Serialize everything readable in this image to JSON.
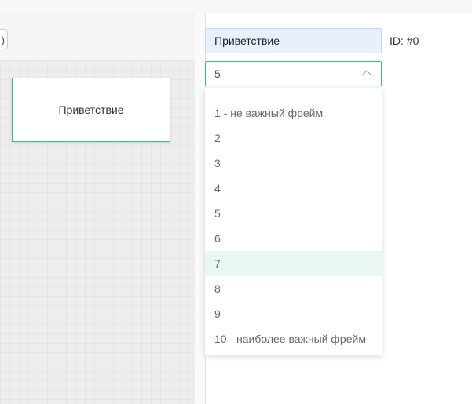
{
  "colors": {
    "accent": "#3fb98b",
    "hover_bg": "#eaf7f1",
    "input_bg": "#e8effd"
  },
  "toolbar": {
    "partial_button_glyph": ")"
  },
  "canvas": {
    "node_title": "Приветствие"
  },
  "properties": {
    "frame_name": "Приветствие",
    "frame_id": "ID: #0",
    "priority_selected": "5",
    "priority_icon": "chevron-up-icon",
    "priority_options": [
      "1 - не важный фрейм",
      "2",
      "3",
      "4",
      "5",
      "6",
      "7",
      "8",
      "9",
      "10 - наиболее важный фрейм"
    ],
    "hovered_option": "7"
  }
}
